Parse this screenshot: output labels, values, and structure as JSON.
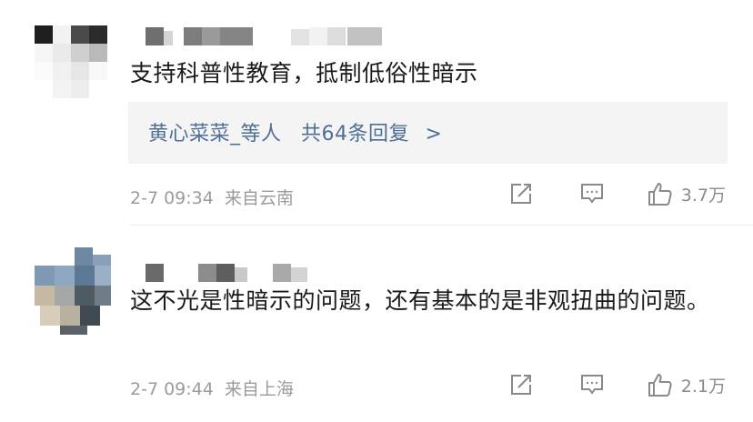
{
  "comments": [
    {
      "text": "支持科普性教育，抵制低俗性暗示",
      "reply": {
        "users": "黄心菜菜_等人",
        "summary": "共64条回复",
        "chevron": ">"
      },
      "date": "2-7 09:34",
      "location": "来自云南",
      "likes": "3.7万",
      "icons": [
        "share-icon",
        "comment-icon",
        "like-icon"
      ]
    },
    {
      "text": "这不光是性暗示的问题，还有基本的是非观扭曲的问题。",
      "date": "2-7 09:44",
      "location": "来自上海",
      "likes": "2.1万",
      "icons": [
        "share-icon",
        "comment-icon",
        "like-icon"
      ]
    }
  ],
  "colors": {
    "reply_link": "#4f6f96",
    "meta_gray": "#9b9b9b",
    "reply_bg": "#f4f4f4"
  }
}
